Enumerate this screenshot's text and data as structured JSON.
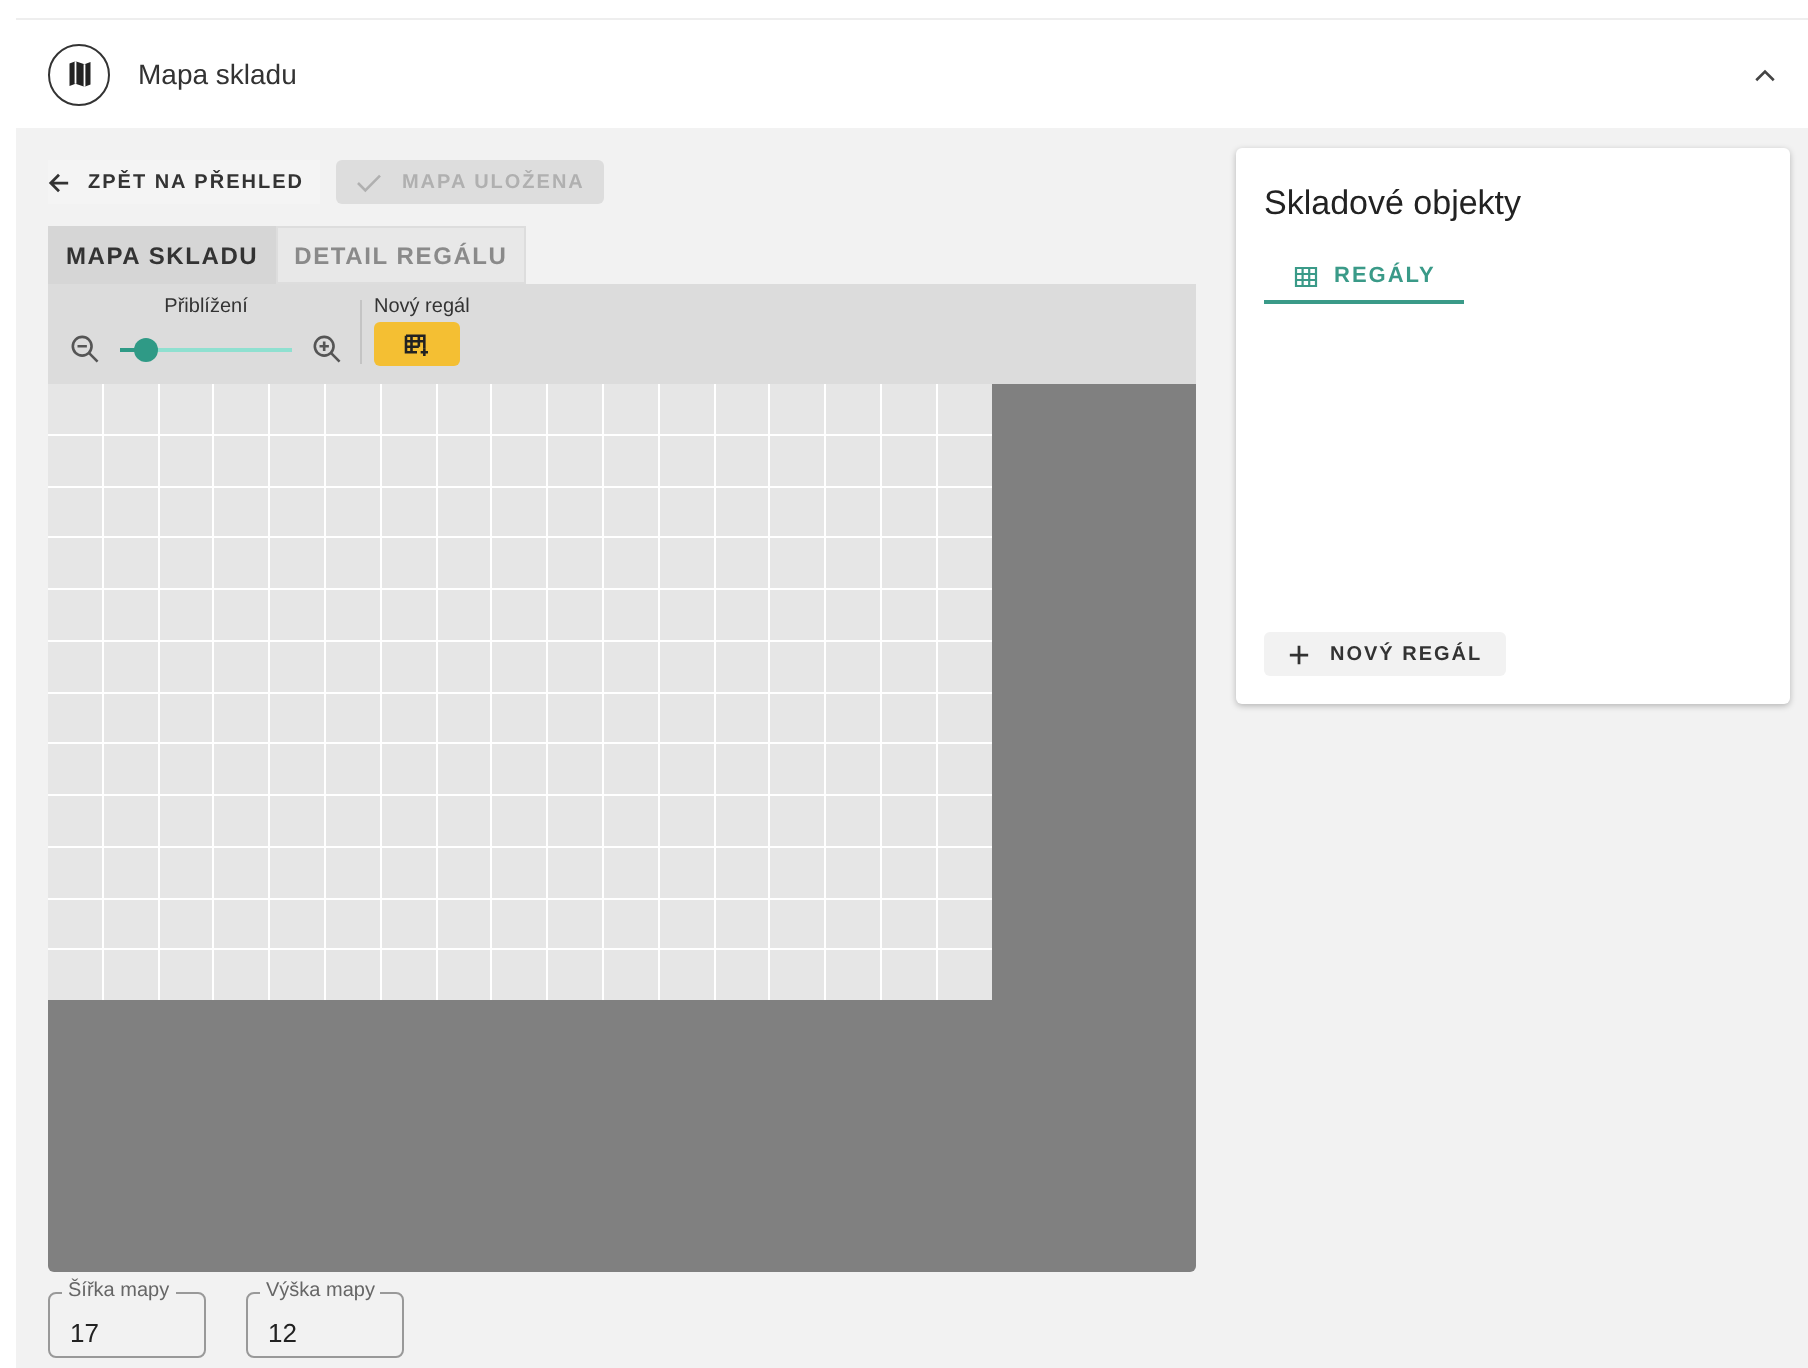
{
  "header": {
    "title": "Mapa skladu",
    "expanded": true
  },
  "toolbar": {
    "back_button": "ZPĚT NA PŘEHLED",
    "save_button": {
      "label": "MAPA ULOŽENA",
      "disabled": true
    }
  },
  "tabs": [
    {
      "label": "MAPA SKLADU",
      "selected": true
    },
    {
      "label": "DETAIL REGÁLU",
      "selected": false
    }
  ],
  "map_tools": {
    "zoom_label": "Přiblížení",
    "zoom": {
      "level": 0.13
    },
    "new_shelf_label": "Nový regál"
  },
  "fields": [
    {
      "label": "Šířka mapy",
      "value": "17"
    },
    {
      "label": "Výška mapy",
      "value": "12"
    }
  ],
  "objects_panel": {
    "title": "Skladové objekty",
    "tabs": [
      {
        "label": "REGÁLY",
        "selected": true
      }
    ],
    "add_button": "NOVÝ REGÁL"
  }
}
